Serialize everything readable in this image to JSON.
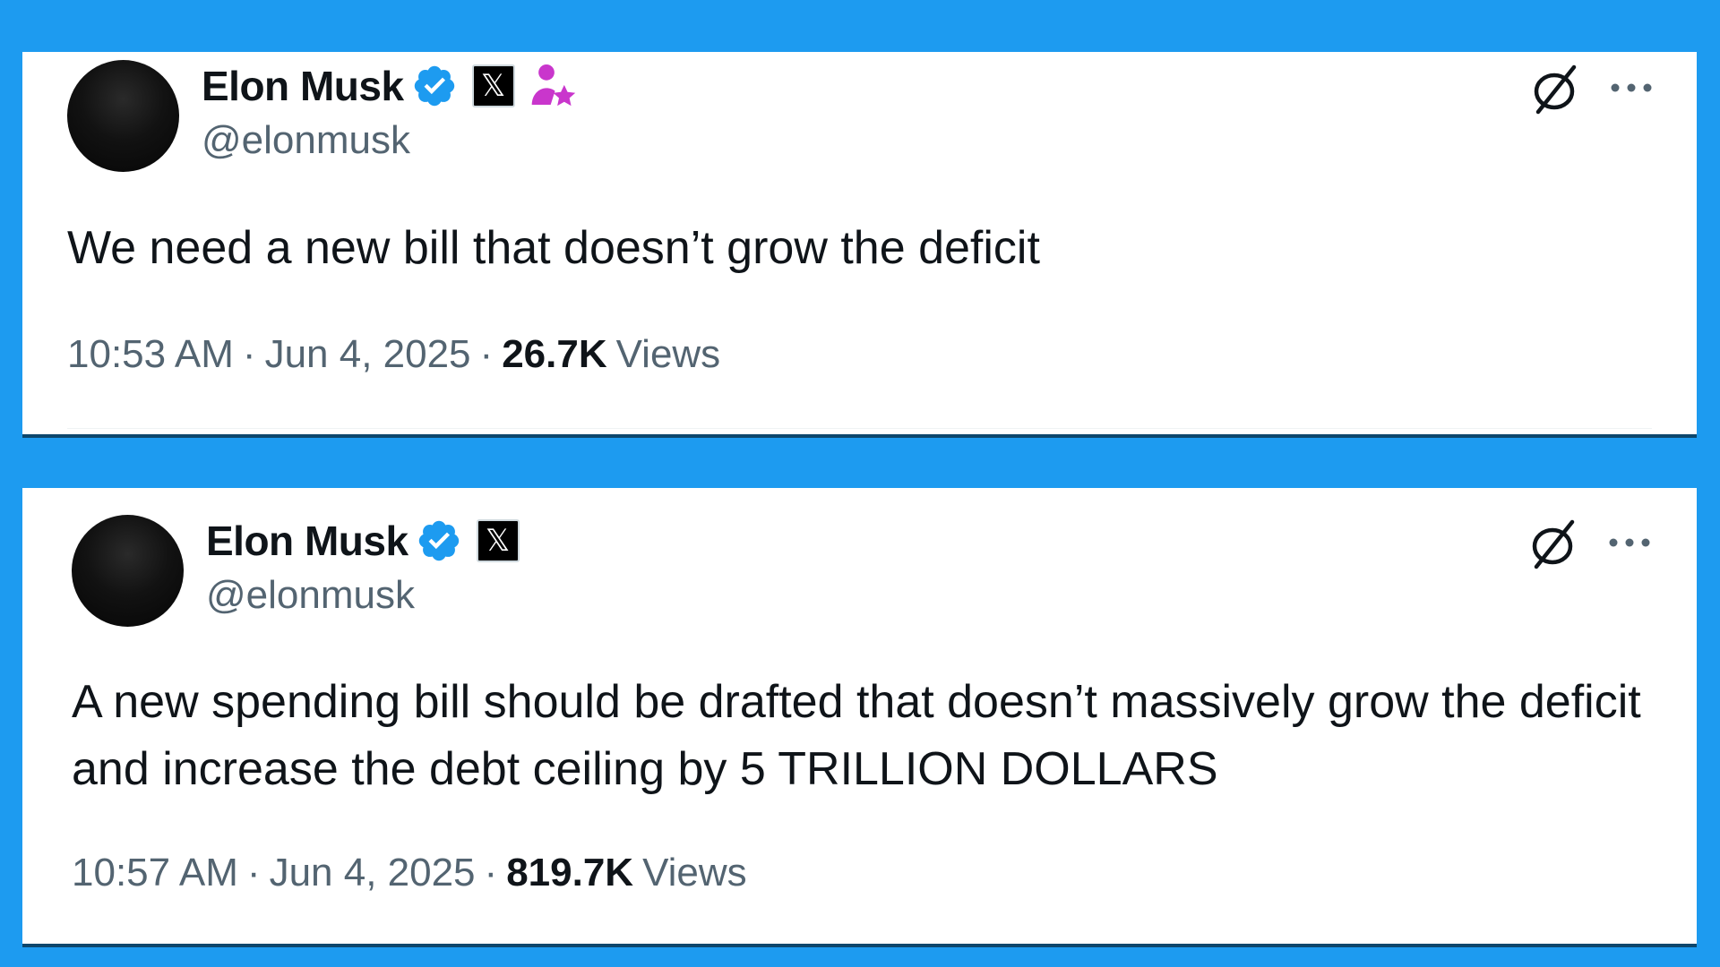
{
  "tweets": [
    {
      "author": {
        "display_name": "Elon Musk",
        "handle": "@elonmusk"
      },
      "badges": [
        "verified-icon",
        "x-affiliate-icon",
        "person-star-icon"
      ],
      "text": "We need a new bill that doesn’t grow the deficit",
      "time": "10:53 AM",
      "date": "Jun 4, 2025",
      "views_count": "26.7K",
      "views_label": "Views"
    },
    {
      "author": {
        "display_name": "Elon Musk",
        "handle": "@elonmusk"
      },
      "badges": [
        "verified-icon",
        "x-affiliate-icon"
      ],
      "text": "A new spending bill should be drafted that doesn’t massively grow the deficit and increase the debt ceiling by 5 TRILLION DOLLARS",
      "time": "10:57 AM",
      "date": "Jun 4, 2025",
      "views_count": "819.7K",
      "views_label": "Views"
    }
  ],
  "glyphs": {
    "separator": "·",
    "x_logo": "𝕏"
  },
  "colors": {
    "background": "#1d9bf0",
    "verified": "#1d9bf0",
    "secondary_text": "#536471",
    "person_star": "#c936cc"
  }
}
